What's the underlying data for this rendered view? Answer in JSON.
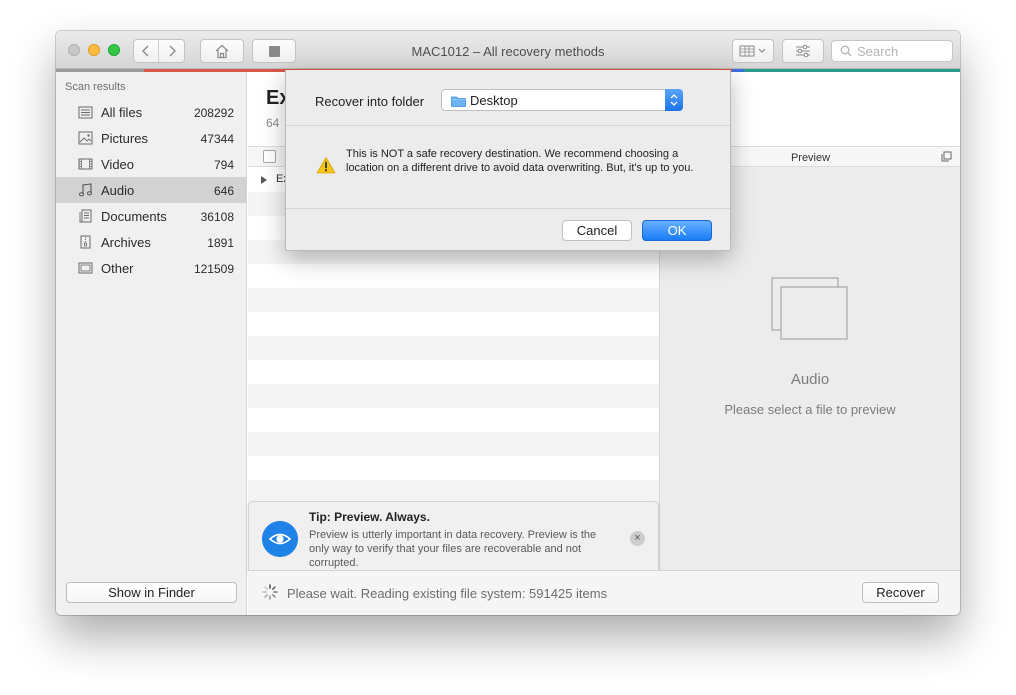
{
  "window": {
    "title": "MAC1012 – All recovery methods",
    "search_placeholder": "Search"
  },
  "colors": {
    "accent_blue": "#1a7cf5",
    "strip_red": "#d8564a",
    "strip_gray": "#9a9a9a",
    "strip_blue": "#3a6fe0",
    "strip_teal": "#2a9a8c",
    "tl_yellow": "#fdbc40",
    "tl_green": "#33c748"
  },
  "sidebar": {
    "heading": "Scan results",
    "items": [
      {
        "label": "All files",
        "count": "208292",
        "icon": "files-icon"
      },
      {
        "label": "Pictures",
        "count": "47344",
        "icon": "pictures-icon"
      },
      {
        "label": "Video",
        "count": "794",
        "icon": "video-icon"
      },
      {
        "label": "Audio",
        "count": "646",
        "icon": "audio-icon",
        "active": true
      },
      {
        "label": "Documents",
        "count": "36108",
        "icon": "documents-icon"
      },
      {
        "label": "Archives",
        "count": "1891",
        "icon": "archives-icon"
      },
      {
        "label": "Other",
        "count": "121509",
        "icon": "other-icon"
      }
    ],
    "show_in_finder": "Show in Finder"
  },
  "main": {
    "title": "Ex",
    "subtitle": "64",
    "row_label": "Ex"
  },
  "preview": {
    "header": "Preview",
    "title": "Audio",
    "subtitle": "Please select a file to preview"
  },
  "tip": {
    "title": "Tip: Preview. Always.",
    "body": "Preview is utterly important in data recovery. Preview is the only way to verify that your files are recoverable and not corrupted.",
    "close_glyph": "×"
  },
  "status": {
    "text": "Please wait. Reading existing file system: 591425 items",
    "recover_label": "Recover"
  },
  "dialog": {
    "label": "Recover into folder",
    "folder": "Desktop",
    "message": "This is NOT a safe recovery destination. We recommend choosing a location on a different drive to avoid data overwriting. But, it's up to you.",
    "cancel_label": "Cancel",
    "ok_label": "OK"
  }
}
